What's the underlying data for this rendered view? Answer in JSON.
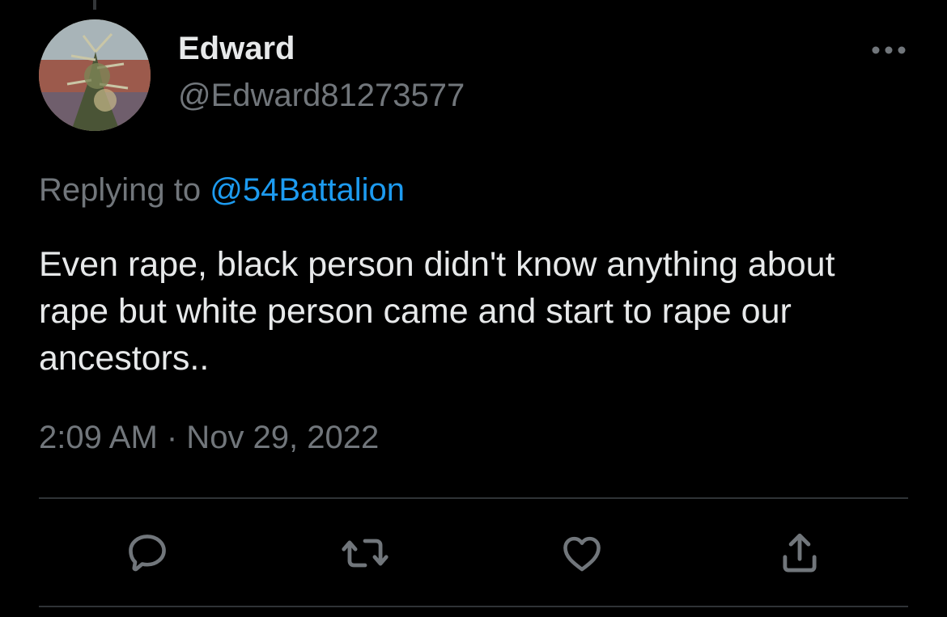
{
  "tweet": {
    "author": {
      "display_name": "Edward",
      "handle": "@Edward81273577",
      "avatar_icon": "avatar-photo-plant"
    },
    "reply": {
      "prefix": "Replying to ",
      "mention": "@54Battalion"
    },
    "text": "Even rape, black person didn't know anything about rape but white person came and start to rape our ancestors..",
    "timestamp": "2:09 AM · Nov 29, 2022"
  },
  "actions": [
    {
      "icon": "reply-icon"
    },
    {
      "icon": "retweet-icon"
    },
    {
      "icon": "like-icon"
    },
    {
      "icon": "share-icon"
    }
  ],
  "colors": {
    "background": "#000000",
    "primary_text": "#e7e9ea",
    "secondary_text": "#71767b",
    "accent": "#1d9bf0",
    "divider": "#2f3336"
  }
}
